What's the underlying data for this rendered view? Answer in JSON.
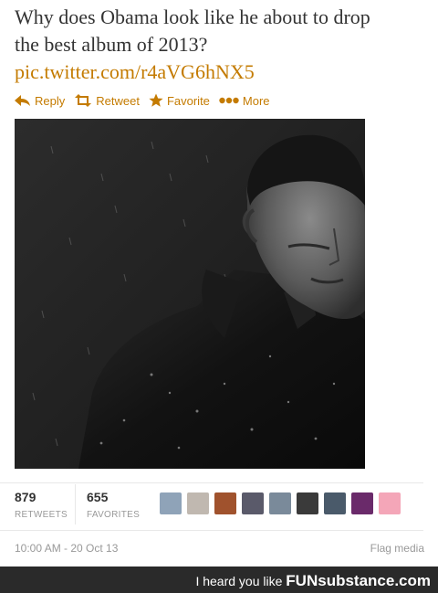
{
  "tweet": {
    "text_line1": "Why does Obama look like he about to drop",
    "text_line2": "the best album of 2013?",
    "link": "pic.twitter.com/r4aVG6hNX5"
  },
  "actions": [
    {
      "label": "Reply",
      "icon": "reply-icon"
    },
    {
      "label": "Retweet",
      "icon": "retweet-icon"
    },
    {
      "label": "Favorite",
      "icon": "star-icon"
    },
    {
      "label": "More",
      "icon": "more-dots-icon"
    }
  ],
  "stats": {
    "retweets": {
      "count": "879",
      "label": "RETWEETS"
    },
    "favorites": {
      "count": "655",
      "label": "FAVORITES"
    }
  },
  "avatar_count": 9,
  "timestamp": "10:00 AM - 20 Oct 13",
  "flag_media": "Flag media",
  "footer": {
    "prefix": "I heard you like",
    "brand": "FUNsubstance.com"
  },
  "colors": {
    "link": "#c47b00",
    "footer_bg": "#2a2a2a"
  }
}
